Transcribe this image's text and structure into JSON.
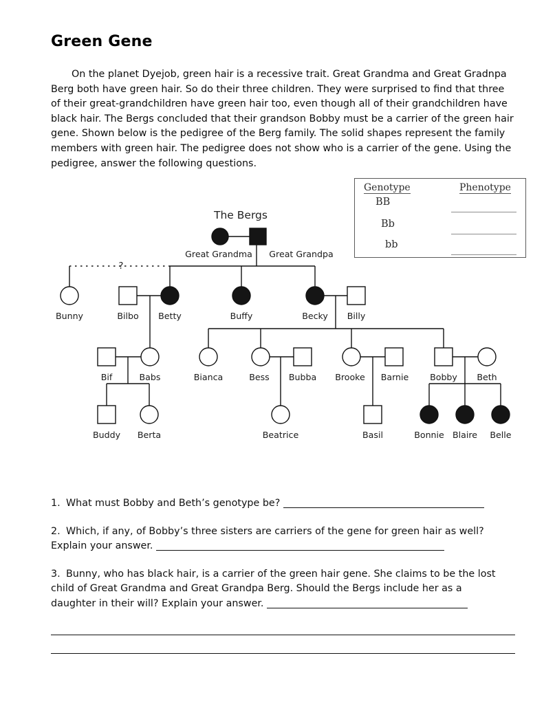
{
  "document": {
    "title": "Green Gene",
    "intro": "On the planet Dyejob, green hair is a recessive trait.  Great Grandma and Great Gradnpa Berg both have green hair.  So do their three children.  They were surprised to find that three of their great-grandchildren have green hair too, even though all of their grandchildren have black hair.  The Bergs concluded that their grandson Bobby must be a carrier of the green hair gene.  Shown below is the pedigree of the Berg family.  The solid shapes represent the family members with green hair.  The pedigree does not show who is a carrier of the gene.  Using the pedigree, answer the following questions."
  },
  "genotype_table": {
    "header_genotype": "Genotype",
    "header_phenotype": "Phenotype",
    "rows": [
      {
        "genotype": "BB",
        "phenotype": ""
      },
      {
        "genotype": "Bb",
        "phenotype": ""
      },
      {
        "genotype": "bb",
        "phenotype": ""
      }
    ]
  },
  "pedigree": {
    "title": "The Bergs",
    "unknown_marker": "?",
    "legend_note": "Solid shapes represent family members with green hair.",
    "people": [
      {
        "id": "great_grandma",
        "name": "Great Grandma",
        "sex": "female",
        "shape": "circle",
        "affected": true,
        "generation": 1
      },
      {
        "id": "great_grandpa",
        "name": "Great Grandpa",
        "sex": "male",
        "shape": "square",
        "affected": true,
        "generation": 1
      },
      {
        "id": "bunny",
        "name": "Bunny",
        "sex": "female",
        "shape": "circle",
        "affected": false,
        "generation": 2
      },
      {
        "id": "bilbo",
        "name": "Bilbo",
        "sex": "male",
        "shape": "square",
        "affected": false,
        "generation": 2
      },
      {
        "id": "betty",
        "name": "Betty",
        "sex": "female",
        "shape": "circle",
        "affected": true,
        "generation": 2
      },
      {
        "id": "buffy",
        "name": "Buffy",
        "sex": "female",
        "shape": "circle",
        "affected": true,
        "generation": 2
      },
      {
        "id": "becky",
        "name": "Becky",
        "sex": "female",
        "shape": "circle",
        "affected": true,
        "generation": 2
      },
      {
        "id": "billy",
        "name": "Billy",
        "sex": "male",
        "shape": "square",
        "affected": false,
        "generation": 2
      },
      {
        "id": "bif",
        "name": "Bif",
        "sex": "male",
        "shape": "square",
        "affected": false,
        "generation": 3
      },
      {
        "id": "babs",
        "name": "Babs",
        "sex": "female",
        "shape": "circle",
        "affected": false,
        "generation": 3
      },
      {
        "id": "bianca",
        "name": "Bianca",
        "sex": "female",
        "shape": "circle",
        "affected": false,
        "generation": 3
      },
      {
        "id": "bess",
        "name": "Bess",
        "sex": "female",
        "shape": "circle",
        "affected": false,
        "generation": 3
      },
      {
        "id": "bubba",
        "name": "Bubba",
        "sex": "male",
        "shape": "square",
        "affected": false,
        "generation": 3
      },
      {
        "id": "brooke",
        "name": "Brooke",
        "sex": "female",
        "shape": "circle",
        "affected": false,
        "generation": 3
      },
      {
        "id": "barnie",
        "name": "Barnie",
        "sex": "male",
        "shape": "square",
        "affected": false,
        "generation": 3
      },
      {
        "id": "bobby",
        "name": "Bobby",
        "sex": "male",
        "shape": "square",
        "affected": false,
        "generation": 3
      },
      {
        "id": "beth",
        "name": "Beth",
        "sex": "female",
        "shape": "circle",
        "affected": false,
        "generation": 3
      },
      {
        "id": "buddy",
        "name": "Buddy",
        "sex": "male",
        "shape": "square",
        "affected": false,
        "generation": 4
      },
      {
        "id": "berta",
        "name": "Berta",
        "sex": "female",
        "shape": "circle",
        "affected": false,
        "generation": 4
      },
      {
        "id": "beatrice",
        "name": "Beatrice",
        "sex": "female",
        "shape": "circle",
        "affected": false,
        "generation": 4
      },
      {
        "id": "basil",
        "name": "Basil",
        "sex": "male",
        "shape": "square",
        "affected": false,
        "generation": 4
      },
      {
        "id": "bonnie",
        "name": "Bonnie",
        "sex": "female",
        "shape": "circle",
        "affected": true,
        "generation": 4
      },
      {
        "id": "blaire",
        "name": "Blaire",
        "sex": "female",
        "shape": "circle",
        "affected": true,
        "generation": 4
      },
      {
        "id": "belle",
        "name": "Belle",
        "sex": "female",
        "shape": "circle",
        "affected": true,
        "generation": 4
      }
    ]
  },
  "questions": [
    {
      "number": "1.",
      "text": "What must Bobby and Beth’s genotype be?",
      "answer": ""
    },
    {
      "number": "2.",
      "text_line1": "Which, if any, of Bobby’s three sisters are carriers of the gene for green hair as well?",
      "text_line2": "Explain your answer.",
      "answer": ""
    },
    {
      "number": "3.",
      "text_line1": "Bunny, who has black hair, is a carrier of the green hair gene.  She claims to be the lost",
      "text_line2": "child of Great Grandma and Great Grandpa Berg.  Should the Bergs include her as a",
      "text_line3": "daughter in their will?  Explain your answer.",
      "answer": ""
    }
  ],
  "names": {
    "great_grandma": "Great Grandma",
    "great_grandpa": "Great Grandpa",
    "bunny": "Bunny",
    "bilbo": "Bilbo",
    "betty": "Betty",
    "buffy": "Buffy",
    "becky": "Becky",
    "billy": "Billy",
    "bif": "Bif",
    "babs": "Babs",
    "bianca": "Bianca",
    "bess": "Bess",
    "bubba": "Bubba",
    "brooke": "Brooke",
    "barnie": "Barnie",
    "bobby": "Bobby",
    "beth": "Beth",
    "buddy": "Buddy",
    "berta": "Berta",
    "beatrice": "Beatrice",
    "basil": "Basil",
    "bonnie": "Bonnie",
    "blaire": "Blaire",
    "belle": "Belle"
  },
  "colors": {
    "affected_fill": "#151515",
    "unaffected_fill": "#ffffff",
    "stroke": "#111111",
    "text": "#111111",
    "table_border": "#5a5a5a"
  }
}
